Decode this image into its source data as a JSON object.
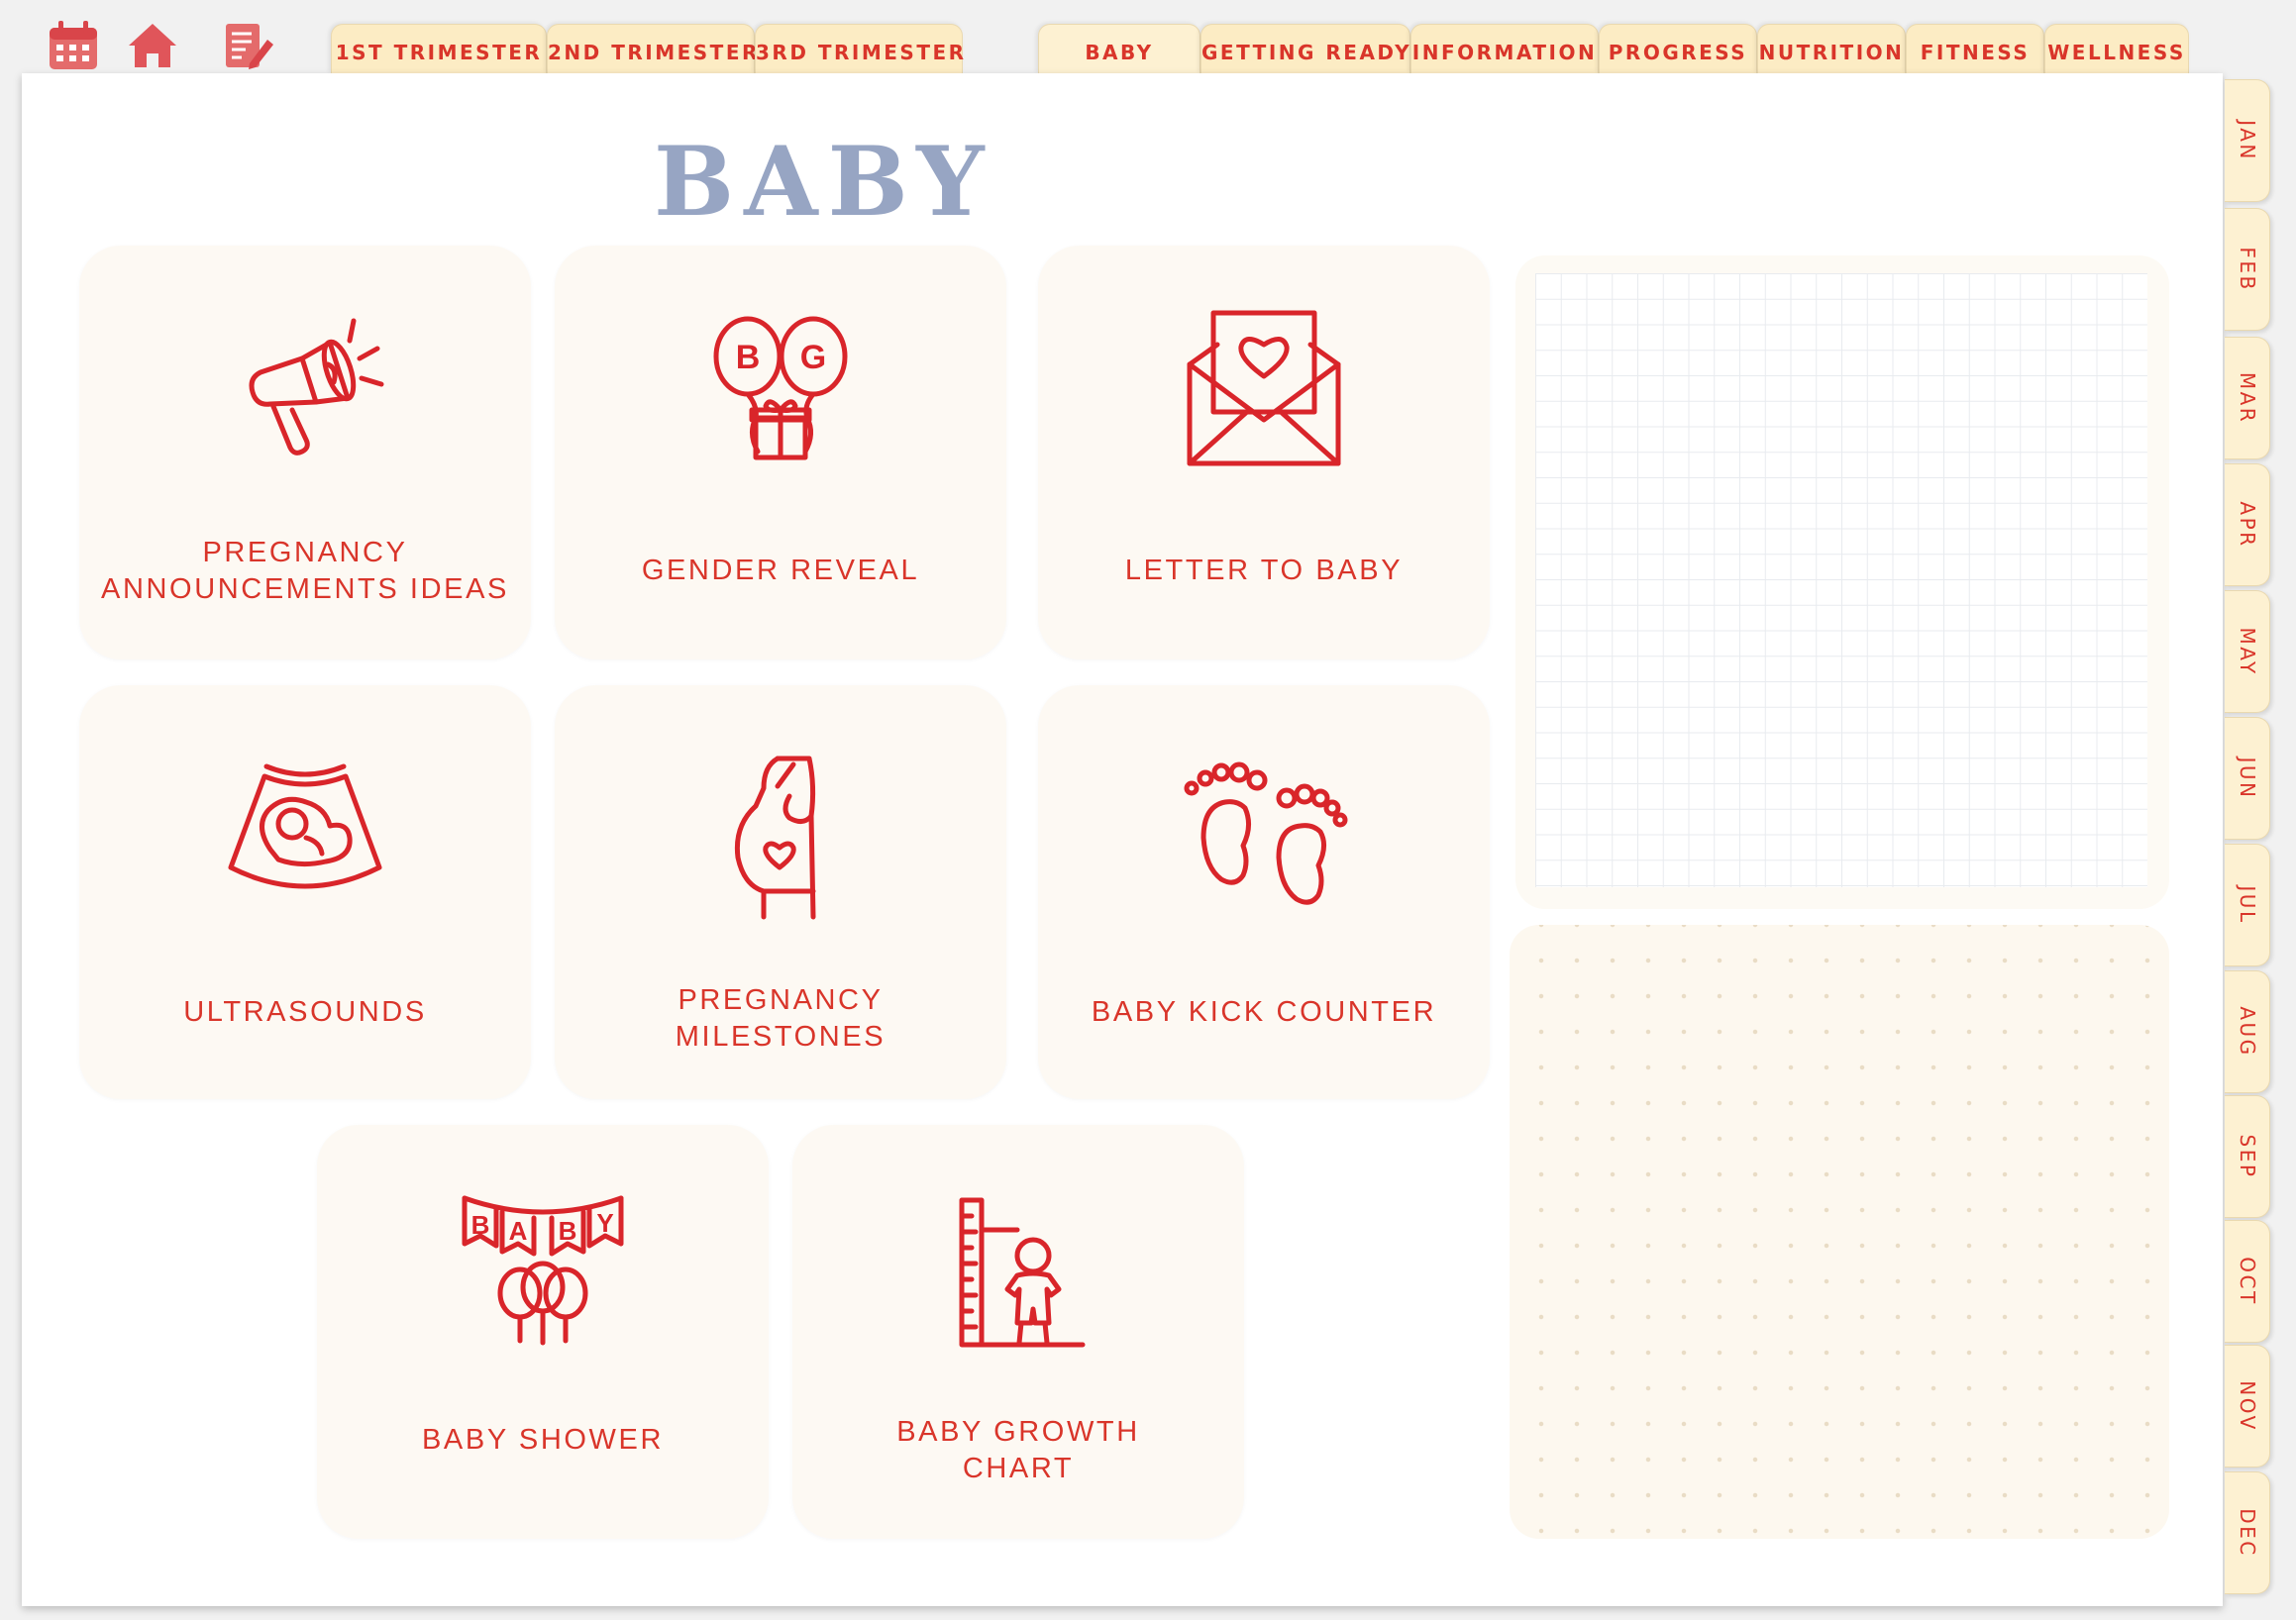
{
  "toolbar": {
    "icons": [
      "calendar-icon",
      "home-icon",
      "notes-icon"
    ]
  },
  "trimester_tabs": [
    "1ST TRIMESTER",
    "2ND TRIMESTER",
    "3RD TRIMESTER"
  ],
  "section_tabs": [
    "BABY",
    "GETTING READY",
    "INFORMATION",
    "PROGRESS",
    "NUTRITION",
    "FITNESS",
    "WELLNESS"
  ],
  "month_tabs": [
    "JAN",
    "FEB",
    "MAR",
    "APR",
    "MAY",
    "JUN",
    "JUL",
    "AUG",
    "SEP",
    "OCT",
    "NOV",
    "DEC"
  ],
  "page": {
    "title": "BABY"
  },
  "cards": [
    {
      "line1": "PREGNANCY",
      "line2": "ANNOUNCEMENTS IDEAS",
      "icon": "megaphone-icon"
    },
    {
      "line1": "GENDER REVEAL",
      "line2": "",
      "icon": "gender-balloons-icon",
      "b": "B",
      "g": "G"
    },
    {
      "line1": "LETTER TO BABY",
      "line2": "",
      "icon": "love-letter-icon"
    },
    {
      "line1": "ULTRASOUNDS",
      "line2": "",
      "icon": "ultrasound-icon"
    },
    {
      "line1": "PREGNANCY",
      "line2": "MILESTONES",
      "icon": "pregnant-woman-icon"
    },
    {
      "line1": "BABY KICK COUNTER",
      "line2": "",
      "icon": "baby-feet-icon"
    },
    {
      "line1": "BABY SHOWER",
      "line2": "",
      "icon": "baby-banner-icon",
      "banner": [
        "B",
        "A",
        "B",
        "Y"
      ]
    },
    {
      "line1": "BABY GROWTH",
      "line2": "CHART",
      "icon": "growth-chart-icon"
    }
  ],
  "colors": {
    "accent": "#d9352a",
    "title": "#97a5c3",
    "tab": "#fcecc4",
    "card": "#fdf9f3"
  }
}
